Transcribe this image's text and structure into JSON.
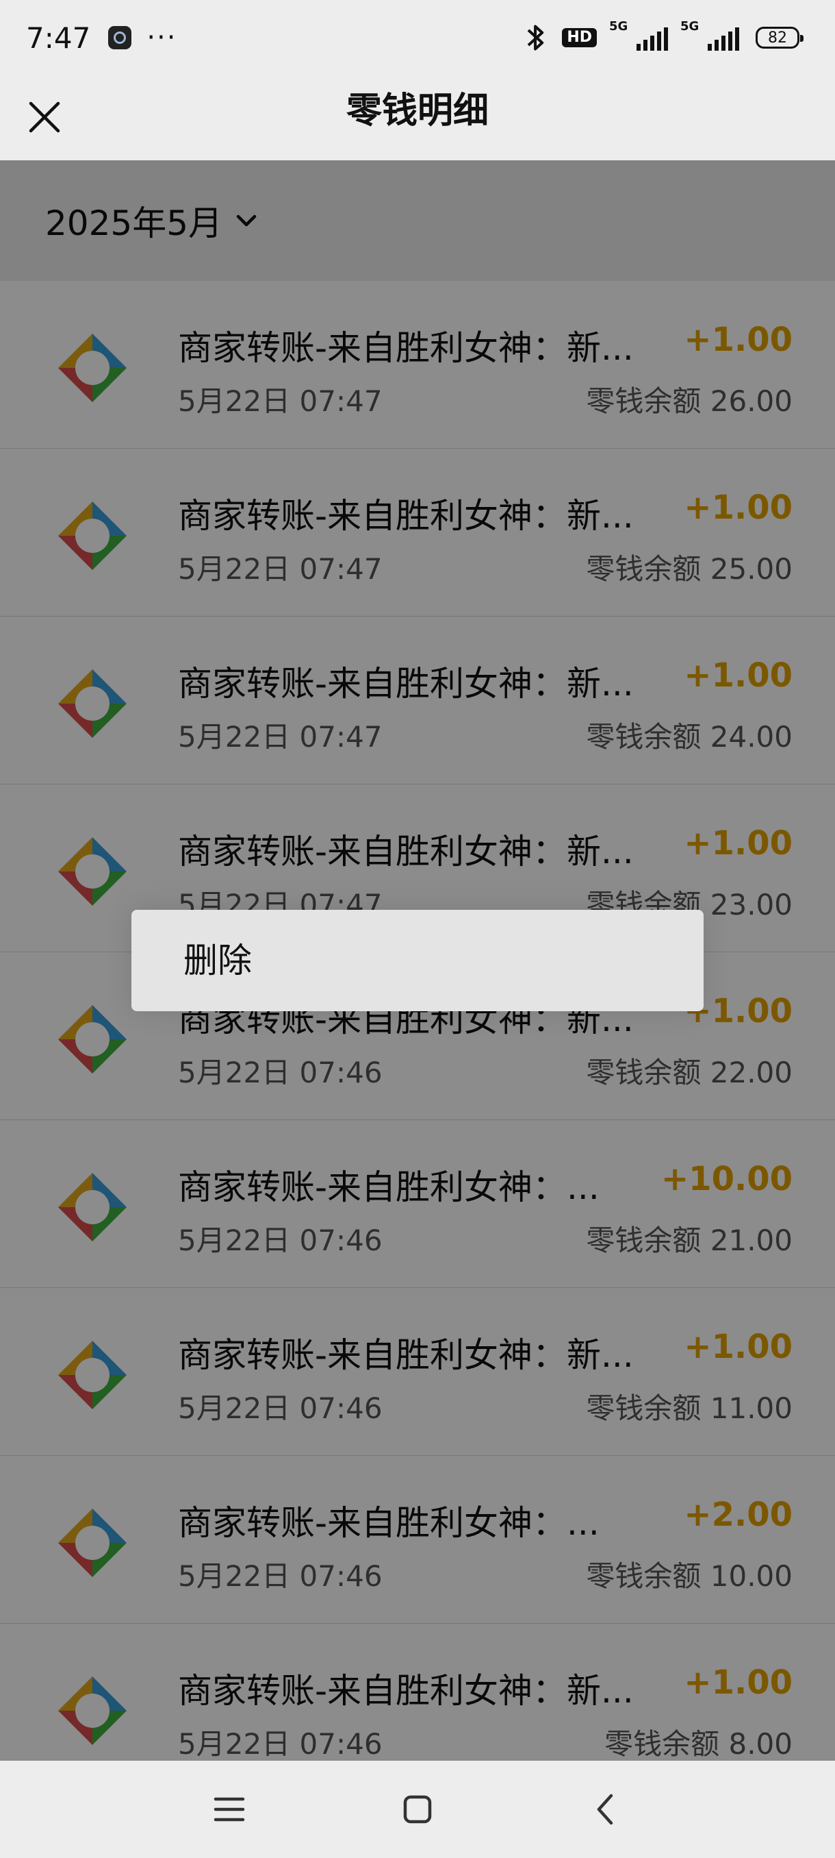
{
  "status_bar": {
    "time": "7:47",
    "dots": "···",
    "hd_label": "HD",
    "network_1": "5G",
    "network_2": "5G",
    "battery": "82"
  },
  "header": {
    "title": "零钱明细"
  },
  "month_selector": {
    "label": "2025年5月"
  },
  "colors": {
    "amount": "#e1a000",
    "icon_orange": "#e0a81c",
    "icon_blue": "#3a9bd8",
    "icon_red": "#d84b4b",
    "icon_green": "#3fae3f"
  },
  "transactions": [
    {
      "title": "商家转账-来自胜利女神：新...",
      "time": "5月22日 07:47",
      "amount": "+1.00",
      "balance": "零钱余额 26.00"
    },
    {
      "title": "商家转账-来自胜利女神：新...",
      "time": "5月22日 07:47",
      "amount": "+1.00",
      "balance": "零钱余额 25.00"
    },
    {
      "title": "商家转账-来自胜利女神：新...",
      "time": "5月22日 07:47",
      "amount": "+1.00",
      "balance": "零钱余额 24.00"
    },
    {
      "title": "商家转账-来自胜利女神：新...",
      "time": "5月22日 07:47",
      "amount": "+1.00",
      "balance": "零钱余额 23.00"
    },
    {
      "title": "商家转账-来自胜利女神：新...",
      "time": "5月22日 07:46",
      "amount": "+1.00",
      "balance": "零钱余额 22.00"
    },
    {
      "title": "商家转账-来自胜利女神：...",
      "time": "5月22日 07:46",
      "amount": "+10.00",
      "balance": "零钱余额 21.00"
    },
    {
      "title": "商家转账-来自胜利女神：新...",
      "time": "5月22日 07:46",
      "amount": "+1.00",
      "balance": "零钱余额 11.00"
    },
    {
      "title": "商家转账-来自胜利女神：...",
      "time": "5月22日 07:46",
      "amount": "+2.00",
      "balance": "零钱余额 10.00"
    },
    {
      "title": "商家转账-来自胜利女神：新...",
      "time": "5月22日 07:46",
      "amount": "+1.00",
      "balance": "零钱余额 8.00"
    }
  ],
  "context_menu": {
    "delete_label": "删除"
  },
  "icons": {
    "close": "close-icon",
    "chevron": "chevron-down-icon",
    "merchant": "merchant-transfer-icon",
    "menu": "menu-icon",
    "home": "home-icon",
    "back": "back-icon"
  }
}
